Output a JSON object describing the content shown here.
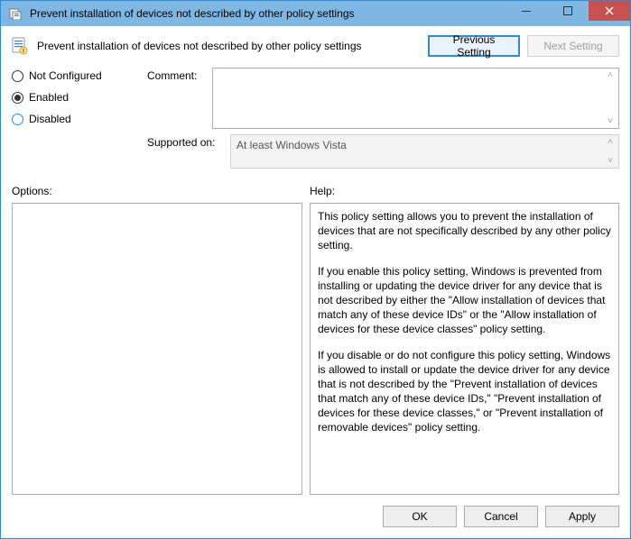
{
  "window": {
    "title": "Prevent installation of devices not described by other policy settings"
  },
  "header": {
    "policy_title": "Prevent installation of devices not described by other policy settings",
    "previous_setting": "Previous Setting",
    "next_setting": "Next Setting"
  },
  "radios": {
    "not_configured": "Not Configured",
    "enabled": "Enabled",
    "disabled": "Disabled",
    "selected": "enabled"
  },
  "fields": {
    "comment_label": "Comment:",
    "comment_value": "",
    "supported_label": "Supported on:",
    "supported_value": "At least Windows Vista"
  },
  "lower": {
    "options_label": "Options:",
    "help_label": "Help:",
    "help_p1": "This policy setting allows you to prevent the installation of devices that are not specifically described by any other policy setting.",
    "help_p2": "If you enable this policy setting, Windows is prevented from installing or updating the device driver for any device that is not described by either the \"Allow installation of devices that match any of these device IDs\" or the \"Allow installation of devices for these device classes\" policy setting.",
    "help_p3": "If you disable or do not configure this policy setting, Windows is allowed to install or update the device driver for any device that is not described by the \"Prevent installation of devices that match any of these device IDs,\" \"Prevent installation of devices for these device classes,\" or \"Prevent installation of removable devices\" policy setting."
  },
  "buttons": {
    "ok": "OK",
    "cancel": "Cancel",
    "apply": "Apply"
  }
}
